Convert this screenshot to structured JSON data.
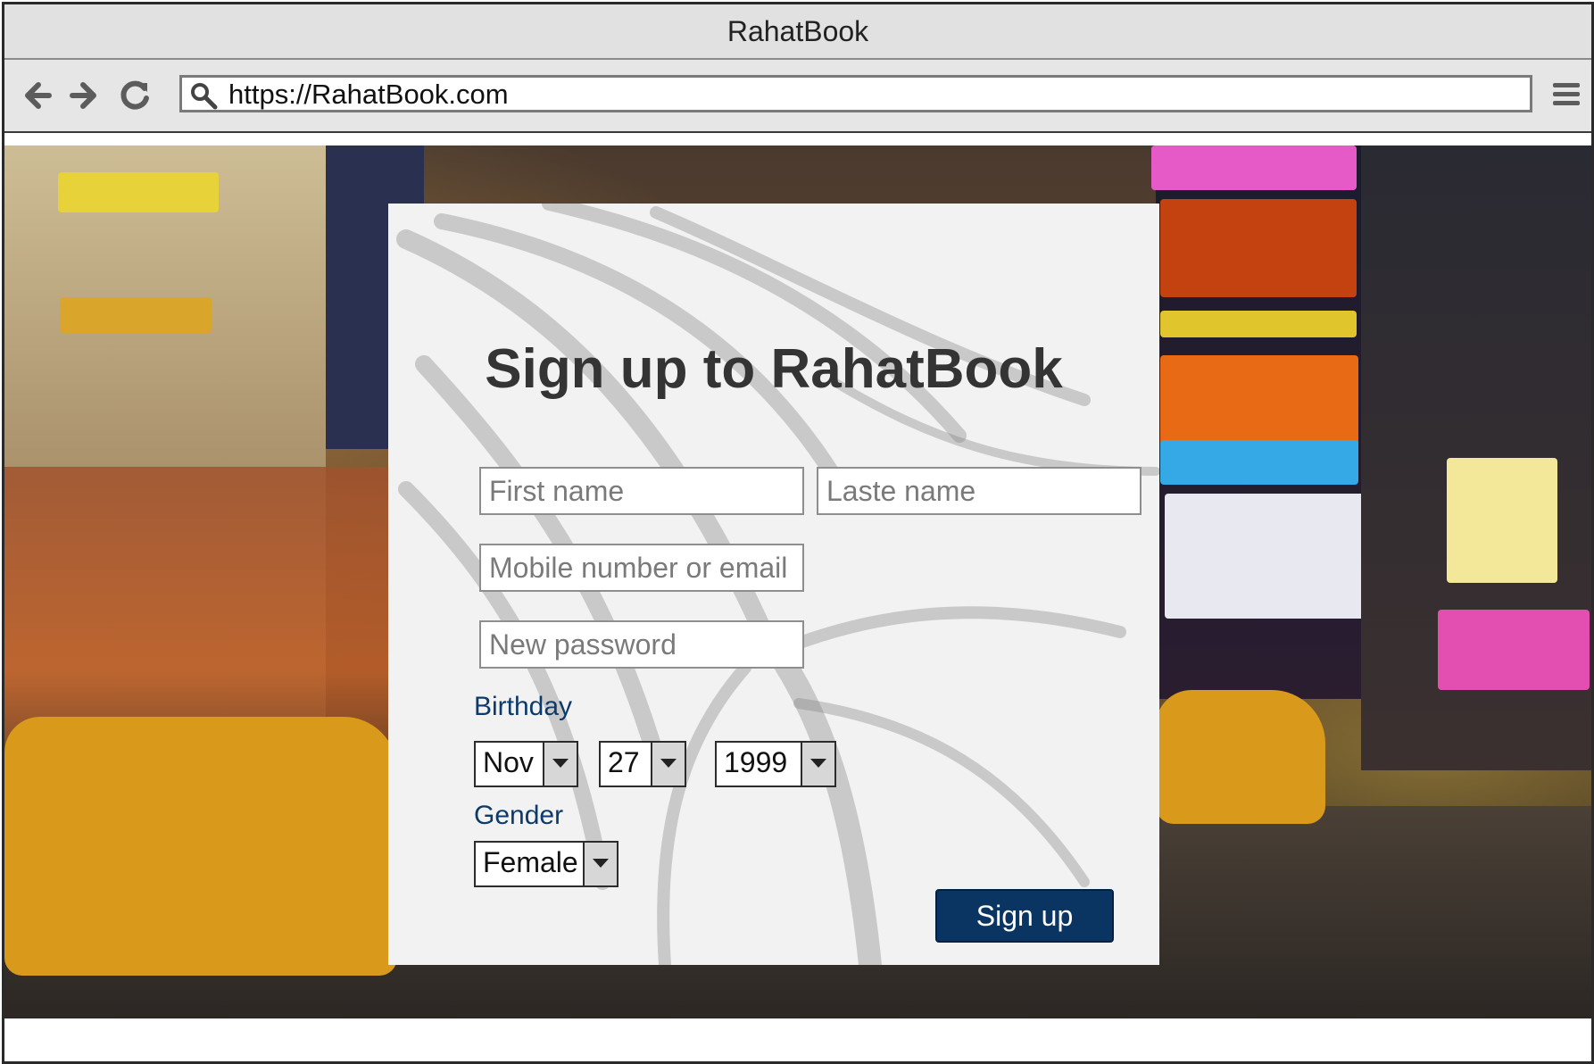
{
  "window": {
    "title": "RahatBook"
  },
  "browser": {
    "url": "https://RahatBook.com",
    "icons": [
      "back-arrow-icon",
      "forward-arrow-icon",
      "reload-icon",
      "search-icon",
      "menu-icon"
    ]
  },
  "form": {
    "heading": "Sign up to RahatBook",
    "first_name_placeholder": "First name",
    "last_name_placeholder": "Laste name",
    "contact_placeholder": "Mobile number or email",
    "password_placeholder": "New password",
    "birthday_label": "Birthday",
    "birthday": {
      "month": "Nov",
      "day": "27",
      "year": "1999"
    },
    "gender_label": "Gender",
    "gender": "Female",
    "submit_label": "Sign up"
  },
  "colors": {
    "accent": "#0a3462",
    "label": "#0c3a6b",
    "card": "#f2f2f2"
  }
}
